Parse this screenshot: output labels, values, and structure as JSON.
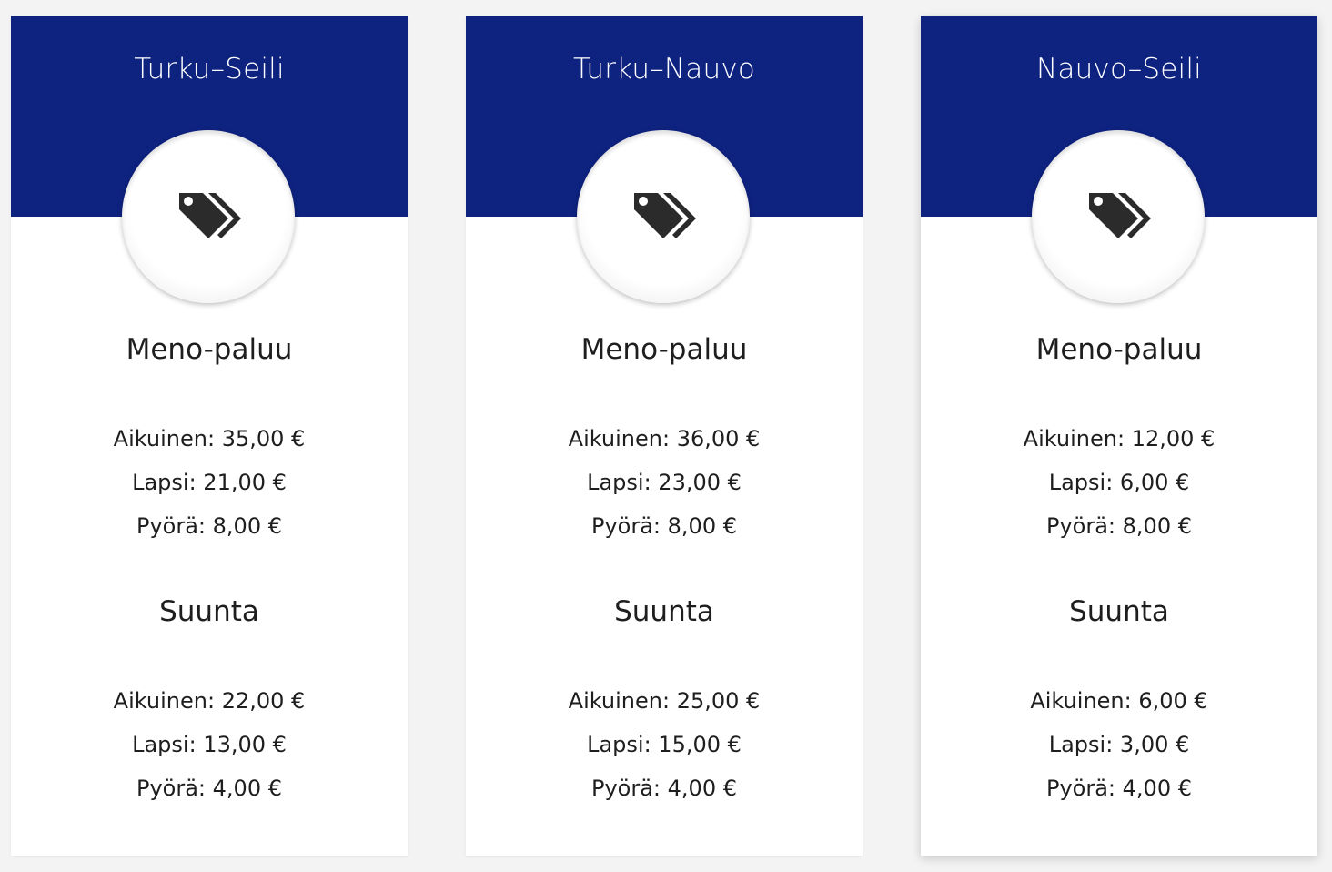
{
  "cards": [
    {
      "route": "Turku–Seili",
      "icon": "price-tags-icon",
      "sections": [
        {
          "title": "Meno-paluu",
          "prices": [
            "Aikuinen: 35,00 €",
            "Lapsi: 21,00 €",
            "Pyörä: 8,00 €"
          ]
        },
        {
          "title": "Suunta",
          "prices": [
            "Aikuinen: 22,00 €",
            "Lapsi: 13,00 €",
            "Pyörä: 4,00 €"
          ]
        }
      ]
    },
    {
      "route": "Turku–Nauvo",
      "icon": "price-tags-icon",
      "sections": [
        {
          "title": "Meno-paluu",
          "prices": [
            "Aikuinen: 36,00 €",
            "Lapsi: 23,00 €",
            "Pyörä: 8,00 €"
          ]
        },
        {
          "title": "Suunta",
          "prices": [
            "Aikuinen: 25,00 €",
            "Lapsi: 15,00 €",
            "Pyörä: 4,00 €"
          ]
        }
      ]
    },
    {
      "route": "Nauvo–Seili",
      "icon": "price-tags-icon",
      "sections": [
        {
          "title": "Meno-paluu",
          "prices": [
            "Aikuinen: 12,00 €",
            "Lapsi: 6,00 €",
            "Pyörä: 8,00 €"
          ]
        },
        {
          "title": "Suunta",
          "prices": [
            "Aikuinen: 6,00 €",
            "Lapsi: 3,00 €",
            "Pyörä: 4,00 €"
          ]
        }
      ]
    }
  ],
  "colors": {
    "header": "#0e2280",
    "card": "#ffffff",
    "background": "#f3f3f3",
    "text": "#1e1e1e",
    "icon": "#2b2b2b"
  }
}
